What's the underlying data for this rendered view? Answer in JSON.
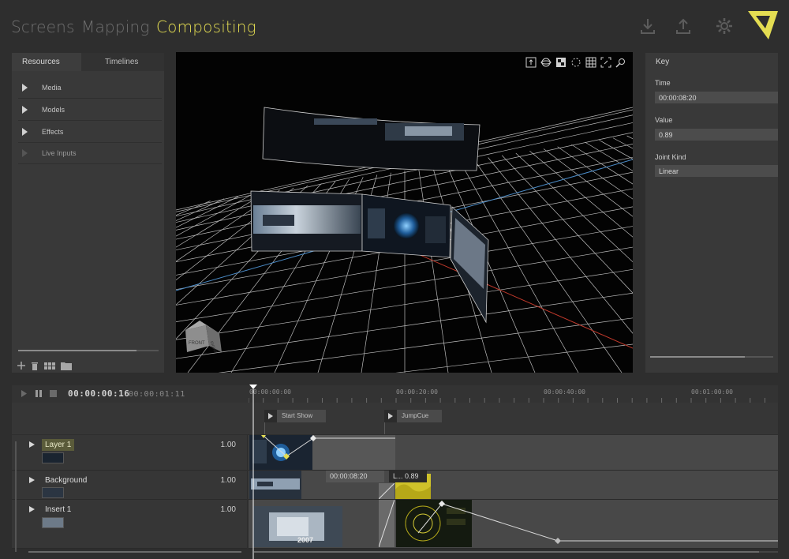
{
  "nav": {
    "tabs": [
      {
        "label": "Screens",
        "active": false
      },
      {
        "label": "Mapping",
        "active": false
      },
      {
        "label": "Compositing",
        "active": true
      }
    ],
    "icons": [
      "download-icon",
      "upload-icon",
      "gear-icon"
    ],
    "accent_color": "#e4dd52"
  },
  "resources": {
    "tabs": [
      {
        "label": "Resources",
        "active": true
      },
      {
        "label": "Timelines",
        "active": false
      }
    ],
    "items": [
      {
        "label": "Media",
        "enabled": true
      },
      {
        "label": "Models",
        "enabled": true
      },
      {
        "label": "Effects",
        "enabled": true
      },
      {
        "label": "Live Inputs",
        "enabled": false
      }
    ],
    "toolbar_icons": [
      "add-icon",
      "trash-icon",
      "grid-icon",
      "folder-icon"
    ]
  },
  "viewport": {
    "toolbar_icons": [
      "export-view-icon",
      "orbit-icon",
      "texture-icon",
      "selection-icon",
      "grid-icon",
      "fit-icon",
      "zoom-icon"
    ],
    "view_cube": {
      "front_label": "FRONT",
      "side_label": "RIGHT"
    }
  },
  "key": {
    "title": "Key",
    "time_label": "Time",
    "time_value": "00:00:08:20",
    "value_label": "Value",
    "value_value": "0.89",
    "joint_label": "Joint Kind",
    "joint_value": "Linear"
  },
  "timeline": {
    "current_time": "00:00:00:16",
    "duration": "00:00:01:11",
    "ruler": [
      "00:00:00:00",
      "00:00:20:00",
      "00:00:40:00",
      "00:01:00:00"
    ],
    "cues": [
      {
        "label": "Start Show"
      },
      {
        "label": "JumpCue"
      }
    ],
    "tracks": [
      {
        "name": "Layer 1",
        "value": "1.00",
        "selected": true
      },
      {
        "name": "Background",
        "value": "1.00",
        "selected": false
      },
      {
        "name": "Insert 1",
        "value": "1.00",
        "selected": false
      }
    ],
    "key_popup": {
      "time": "00:00:08:20",
      "interp": "L...",
      "value": "0.89"
    },
    "clip_text": "2007"
  }
}
